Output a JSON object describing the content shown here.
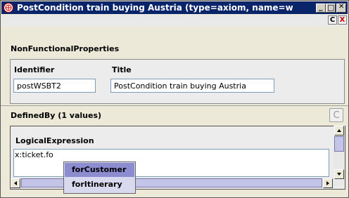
{
  "window": {
    "title": "PostCondition train buying Austria    (type=axiom, name=wsmo_lite_text...",
    "minimize_glyph": "_",
    "maximize_glyph": "□",
    "close_glyph": "✕",
    "c_button": "C",
    "x_button": "X"
  },
  "nfp": {
    "section_label": "NonFunctionalProperties",
    "identifier_label": "Identifier",
    "identifier_value": "postWSBT2",
    "title_label": "Title",
    "title_value": "PostCondition train buying Austria"
  },
  "definedby": {
    "label": "DefinedBy (1 values)",
    "c_button": "C"
  },
  "logical": {
    "label": "LogicalExpression",
    "text": "x:ticket.fo"
  },
  "autocomplete": {
    "items": [
      "forCustomer",
      "forItinerary"
    ],
    "selected_index": 0
  },
  "colors": {
    "titlebar": "#0a246a",
    "popup_selected": "#8c8cd0",
    "popup_bg": "#d8d8ee"
  }
}
